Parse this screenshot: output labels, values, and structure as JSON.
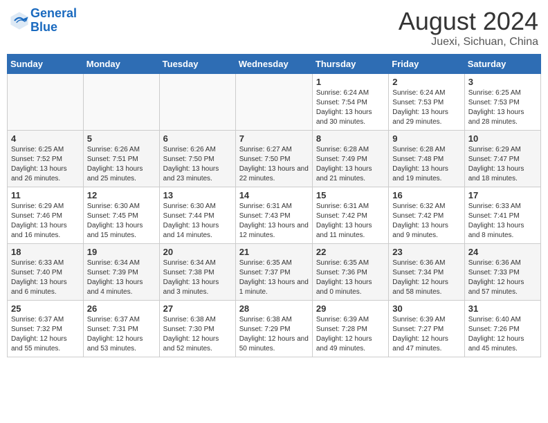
{
  "header": {
    "logo_line1": "General",
    "logo_line2": "Blue",
    "month_year": "August 2024",
    "location": "Juexi, Sichuan, China"
  },
  "days_of_week": [
    "Sunday",
    "Monday",
    "Tuesday",
    "Wednesday",
    "Thursday",
    "Friday",
    "Saturday"
  ],
  "weeks": [
    [
      {
        "num": "",
        "sunrise": "",
        "sunset": "",
        "daylight": "",
        "empty": true
      },
      {
        "num": "",
        "sunrise": "",
        "sunset": "",
        "daylight": "",
        "empty": true
      },
      {
        "num": "",
        "sunrise": "",
        "sunset": "",
        "daylight": "",
        "empty": true
      },
      {
        "num": "",
        "sunrise": "",
        "sunset": "",
        "daylight": "",
        "empty": true
      },
      {
        "num": "1",
        "sunrise": "Sunrise: 6:24 AM",
        "sunset": "Sunset: 7:54 PM",
        "daylight": "Daylight: 13 hours and 30 minutes.",
        "empty": false
      },
      {
        "num": "2",
        "sunrise": "Sunrise: 6:24 AM",
        "sunset": "Sunset: 7:53 PM",
        "daylight": "Daylight: 13 hours and 29 minutes.",
        "empty": false
      },
      {
        "num": "3",
        "sunrise": "Sunrise: 6:25 AM",
        "sunset": "Sunset: 7:53 PM",
        "daylight": "Daylight: 13 hours and 28 minutes.",
        "empty": false
      }
    ],
    [
      {
        "num": "4",
        "sunrise": "Sunrise: 6:25 AM",
        "sunset": "Sunset: 7:52 PM",
        "daylight": "Daylight: 13 hours and 26 minutes.",
        "empty": false
      },
      {
        "num": "5",
        "sunrise": "Sunrise: 6:26 AM",
        "sunset": "Sunset: 7:51 PM",
        "daylight": "Daylight: 13 hours and 25 minutes.",
        "empty": false
      },
      {
        "num": "6",
        "sunrise": "Sunrise: 6:26 AM",
        "sunset": "Sunset: 7:50 PM",
        "daylight": "Daylight: 13 hours and 23 minutes.",
        "empty": false
      },
      {
        "num": "7",
        "sunrise": "Sunrise: 6:27 AM",
        "sunset": "Sunset: 7:50 PM",
        "daylight": "Daylight: 13 hours and 22 minutes.",
        "empty": false
      },
      {
        "num": "8",
        "sunrise": "Sunrise: 6:28 AM",
        "sunset": "Sunset: 7:49 PM",
        "daylight": "Daylight: 13 hours and 21 minutes.",
        "empty": false
      },
      {
        "num": "9",
        "sunrise": "Sunrise: 6:28 AM",
        "sunset": "Sunset: 7:48 PM",
        "daylight": "Daylight: 13 hours and 19 minutes.",
        "empty": false
      },
      {
        "num": "10",
        "sunrise": "Sunrise: 6:29 AM",
        "sunset": "Sunset: 7:47 PM",
        "daylight": "Daylight: 13 hours and 18 minutes.",
        "empty": false
      }
    ],
    [
      {
        "num": "11",
        "sunrise": "Sunrise: 6:29 AM",
        "sunset": "Sunset: 7:46 PM",
        "daylight": "Daylight: 13 hours and 16 minutes.",
        "empty": false
      },
      {
        "num": "12",
        "sunrise": "Sunrise: 6:30 AM",
        "sunset": "Sunset: 7:45 PM",
        "daylight": "Daylight: 13 hours and 15 minutes.",
        "empty": false
      },
      {
        "num": "13",
        "sunrise": "Sunrise: 6:30 AM",
        "sunset": "Sunset: 7:44 PM",
        "daylight": "Daylight: 13 hours and 14 minutes.",
        "empty": false
      },
      {
        "num": "14",
        "sunrise": "Sunrise: 6:31 AM",
        "sunset": "Sunset: 7:43 PM",
        "daylight": "Daylight: 13 hours and 12 minutes.",
        "empty": false
      },
      {
        "num": "15",
        "sunrise": "Sunrise: 6:31 AM",
        "sunset": "Sunset: 7:42 PM",
        "daylight": "Daylight: 13 hours and 11 minutes.",
        "empty": false
      },
      {
        "num": "16",
        "sunrise": "Sunrise: 6:32 AM",
        "sunset": "Sunset: 7:42 PM",
        "daylight": "Daylight: 13 hours and 9 minutes.",
        "empty": false
      },
      {
        "num": "17",
        "sunrise": "Sunrise: 6:33 AM",
        "sunset": "Sunset: 7:41 PM",
        "daylight": "Daylight: 13 hours and 8 minutes.",
        "empty": false
      }
    ],
    [
      {
        "num": "18",
        "sunrise": "Sunrise: 6:33 AM",
        "sunset": "Sunset: 7:40 PM",
        "daylight": "Daylight: 13 hours and 6 minutes.",
        "empty": false
      },
      {
        "num": "19",
        "sunrise": "Sunrise: 6:34 AM",
        "sunset": "Sunset: 7:39 PM",
        "daylight": "Daylight: 13 hours and 4 minutes.",
        "empty": false
      },
      {
        "num": "20",
        "sunrise": "Sunrise: 6:34 AM",
        "sunset": "Sunset: 7:38 PM",
        "daylight": "Daylight: 13 hours and 3 minutes.",
        "empty": false
      },
      {
        "num": "21",
        "sunrise": "Sunrise: 6:35 AM",
        "sunset": "Sunset: 7:37 PM",
        "daylight": "Daylight: 13 hours and 1 minute.",
        "empty": false
      },
      {
        "num": "22",
        "sunrise": "Sunrise: 6:35 AM",
        "sunset": "Sunset: 7:36 PM",
        "daylight": "Daylight: 13 hours and 0 minutes.",
        "empty": false
      },
      {
        "num": "23",
        "sunrise": "Sunrise: 6:36 AM",
        "sunset": "Sunset: 7:34 PM",
        "daylight": "Daylight: 12 hours and 58 minutes.",
        "empty": false
      },
      {
        "num": "24",
        "sunrise": "Sunrise: 6:36 AM",
        "sunset": "Sunset: 7:33 PM",
        "daylight": "Daylight: 12 hours and 57 minutes.",
        "empty": false
      }
    ],
    [
      {
        "num": "25",
        "sunrise": "Sunrise: 6:37 AM",
        "sunset": "Sunset: 7:32 PM",
        "daylight": "Daylight: 12 hours and 55 minutes.",
        "empty": false
      },
      {
        "num": "26",
        "sunrise": "Sunrise: 6:37 AM",
        "sunset": "Sunset: 7:31 PM",
        "daylight": "Daylight: 12 hours and 53 minutes.",
        "empty": false
      },
      {
        "num": "27",
        "sunrise": "Sunrise: 6:38 AM",
        "sunset": "Sunset: 7:30 PM",
        "daylight": "Daylight: 12 hours and 52 minutes.",
        "empty": false
      },
      {
        "num": "28",
        "sunrise": "Sunrise: 6:38 AM",
        "sunset": "Sunset: 7:29 PM",
        "daylight": "Daylight: 12 hours and 50 minutes.",
        "empty": false
      },
      {
        "num": "29",
        "sunrise": "Sunrise: 6:39 AM",
        "sunset": "Sunset: 7:28 PM",
        "daylight": "Daylight: 12 hours and 49 minutes.",
        "empty": false
      },
      {
        "num": "30",
        "sunrise": "Sunrise: 6:39 AM",
        "sunset": "Sunset: 7:27 PM",
        "daylight": "Daylight: 12 hours and 47 minutes.",
        "empty": false
      },
      {
        "num": "31",
        "sunrise": "Sunrise: 6:40 AM",
        "sunset": "Sunset: 7:26 PM",
        "daylight": "Daylight: 12 hours and 45 minutes.",
        "empty": false
      }
    ]
  ]
}
